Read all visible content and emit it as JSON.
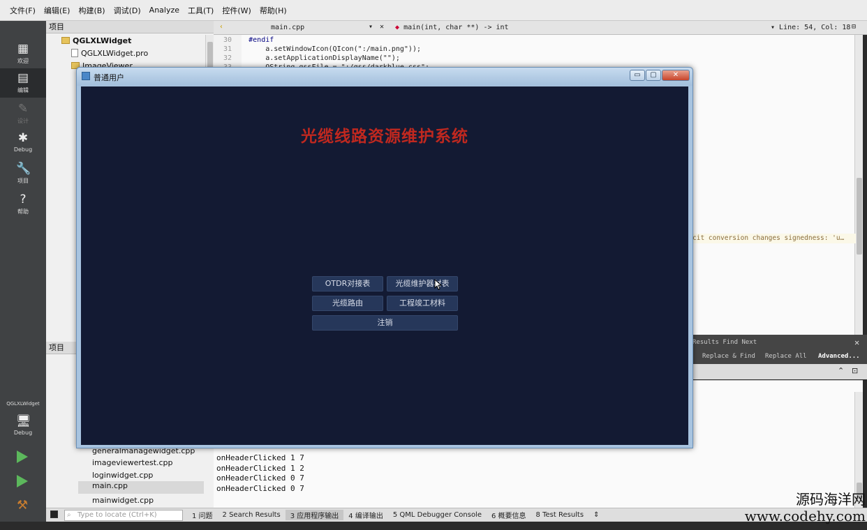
{
  "menubar": {
    "items": [
      "文件(F)",
      "编辑(E)",
      "构建(B)",
      "调试(D)",
      "Analyze",
      "工具(T)",
      "控件(W)",
      "帮助(H)"
    ]
  },
  "modebar": {
    "modes": [
      {
        "label": "欢迎",
        "icon": "grid-icon"
      },
      {
        "label": "编辑",
        "icon": "edit-icon"
      },
      {
        "label": "设计",
        "icon": "pencil-icon"
      },
      {
        "label": "Debug",
        "icon": "bug-icon"
      },
      {
        "label": "项目",
        "icon": "wrench-icon"
      },
      {
        "label": "帮助",
        "icon": "help-icon"
      }
    ],
    "kit": {
      "project": "QGLXLWidget",
      "config": "Debug"
    }
  },
  "project_panel": {
    "header": "项目",
    "tree": [
      {
        "label": "QGLXLWidget",
        "bold": true
      },
      {
        "label": "QGLXLWidget.pro"
      },
      {
        "label": "ImageViewer"
      }
    ],
    "header2": "项目",
    "files": [
      "generalmanagewidget.cpp",
      "imageviewertest.cpp",
      "loginwidget.cpp",
      "main.cpp",
      "mainwidget.cpp"
    ]
  },
  "editor": {
    "file": "main.cpp",
    "symbol": "main(int, char **) -> int",
    "position": "Line: 54, Col: 18",
    "lines": [
      {
        "num": "30",
        "code": "#endif"
      },
      {
        "num": "31",
        "code": "    a.setWindowIcon(QIcon(\":/main.png\"));"
      },
      {
        "num": "32",
        "code": "    a.setApplicationDisplayName(\"\");"
      },
      {
        "num": "33",
        "code": "    QString qssFile = \":/qss/darkblue.css\";"
      }
    ],
    "warning": "cit conversion changes signedness: 'u…"
  },
  "find_panel": {
    "row1": "Results    Find Next",
    "replace": "Replace & Find",
    "replace_all": "Replace All",
    "advanced": "Advanced..."
  },
  "output": {
    "lines": [
      "onHeaderClicked 1 7",
      "onHeaderClicked 1 2",
      "onHeaderClicked 0 7",
      "onHeaderClicked 0 7"
    ]
  },
  "statusbar": {
    "locate_placeholder": "Type to locate (Ctrl+K)",
    "tabs": [
      "1 问题",
      "2 Search Results",
      "3 应用程序输出",
      "4 编译输出",
      "5 QML Debugger Console",
      "6 概要信息",
      "8 Test Results"
    ]
  },
  "dialog": {
    "title": "普通用户",
    "heading": "光缆线路资源维护系统",
    "buttons": {
      "otdr": "OTDR对接表",
      "maintainer": "光缆维护器材表",
      "route": "光缆路由",
      "materials": "工程竣工材料",
      "logout": "注销"
    }
  },
  "watermark": {
    "line1": "源码海洋网",
    "line2": "www.codehy.com"
  },
  "colors": {
    "dialog_bg": "#131a33",
    "heading": "#c0281f",
    "button_bg": "#26375a"
  }
}
